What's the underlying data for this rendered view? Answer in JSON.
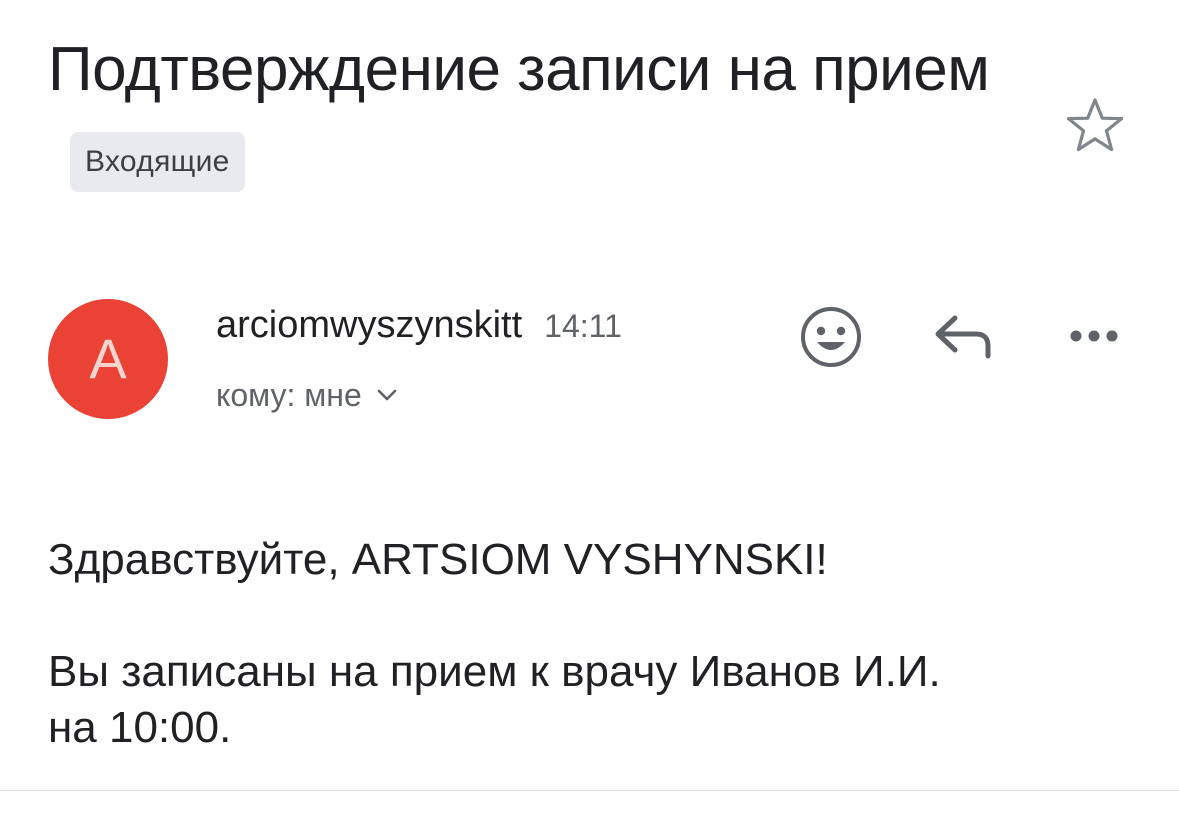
{
  "email": {
    "subject": "Подтверждение записи на прием",
    "label": "Входящие",
    "sender": {
      "name": "arciomwyszynskitt",
      "avatar_letter": "A",
      "avatar_color": "#ea4335",
      "time": "14:11",
      "recipient_text": "кому: мне"
    },
    "body": {
      "greeting": "Здравствуйте, ARTSIOM VYSHYNSKI!",
      "line1": "Вы записаны на прием к врачу Иванов И.И.",
      "line2": "на 10:00."
    }
  },
  "icons": {
    "star": "star-outline-icon",
    "emoji": "add-emoji-reaction-icon",
    "reply": "reply-icon",
    "more": "more-options-icon",
    "recipient_expand": "chevron-down-icon"
  }
}
